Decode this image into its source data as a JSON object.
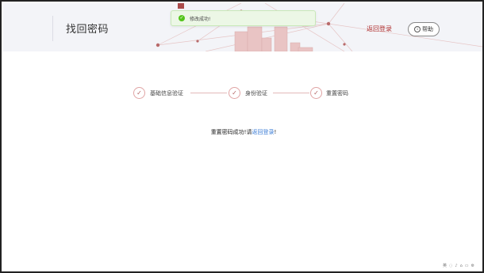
{
  "header": {
    "title": "找回密码",
    "back_login": "返回登录",
    "help_label": "帮助",
    "help_icon_glyph": "i"
  },
  "toast": {
    "icon_glyph": "✓",
    "text": "修改成功!"
  },
  "steps": [
    {
      "label": "基础信息验证",
      "status": "done",
      "glyph": "✓"
    },
    {
      "label": "身份验证",
      "status": "done",
      "glyph": "✓"
    },
    {
      "label": "重置密码",
      "status": "done",
      "glyph": "✓"
    }
  ],
  "result": {
    "prefix": "重置密码成功!请",
    "link": "返回登录",
    "suffix": "!"
  },
  "tray": {
    "items": [
      "英",
      "◌",
      "♪",
      "⌂",
      "▭",
      "⚙"
    ]
  },
  "colors": {
    "accent": "#b03030",
    "link": "#3a7bd5",
    "success": "#52c41a",
    "step_border": "#e0a4a4"
  }
}
